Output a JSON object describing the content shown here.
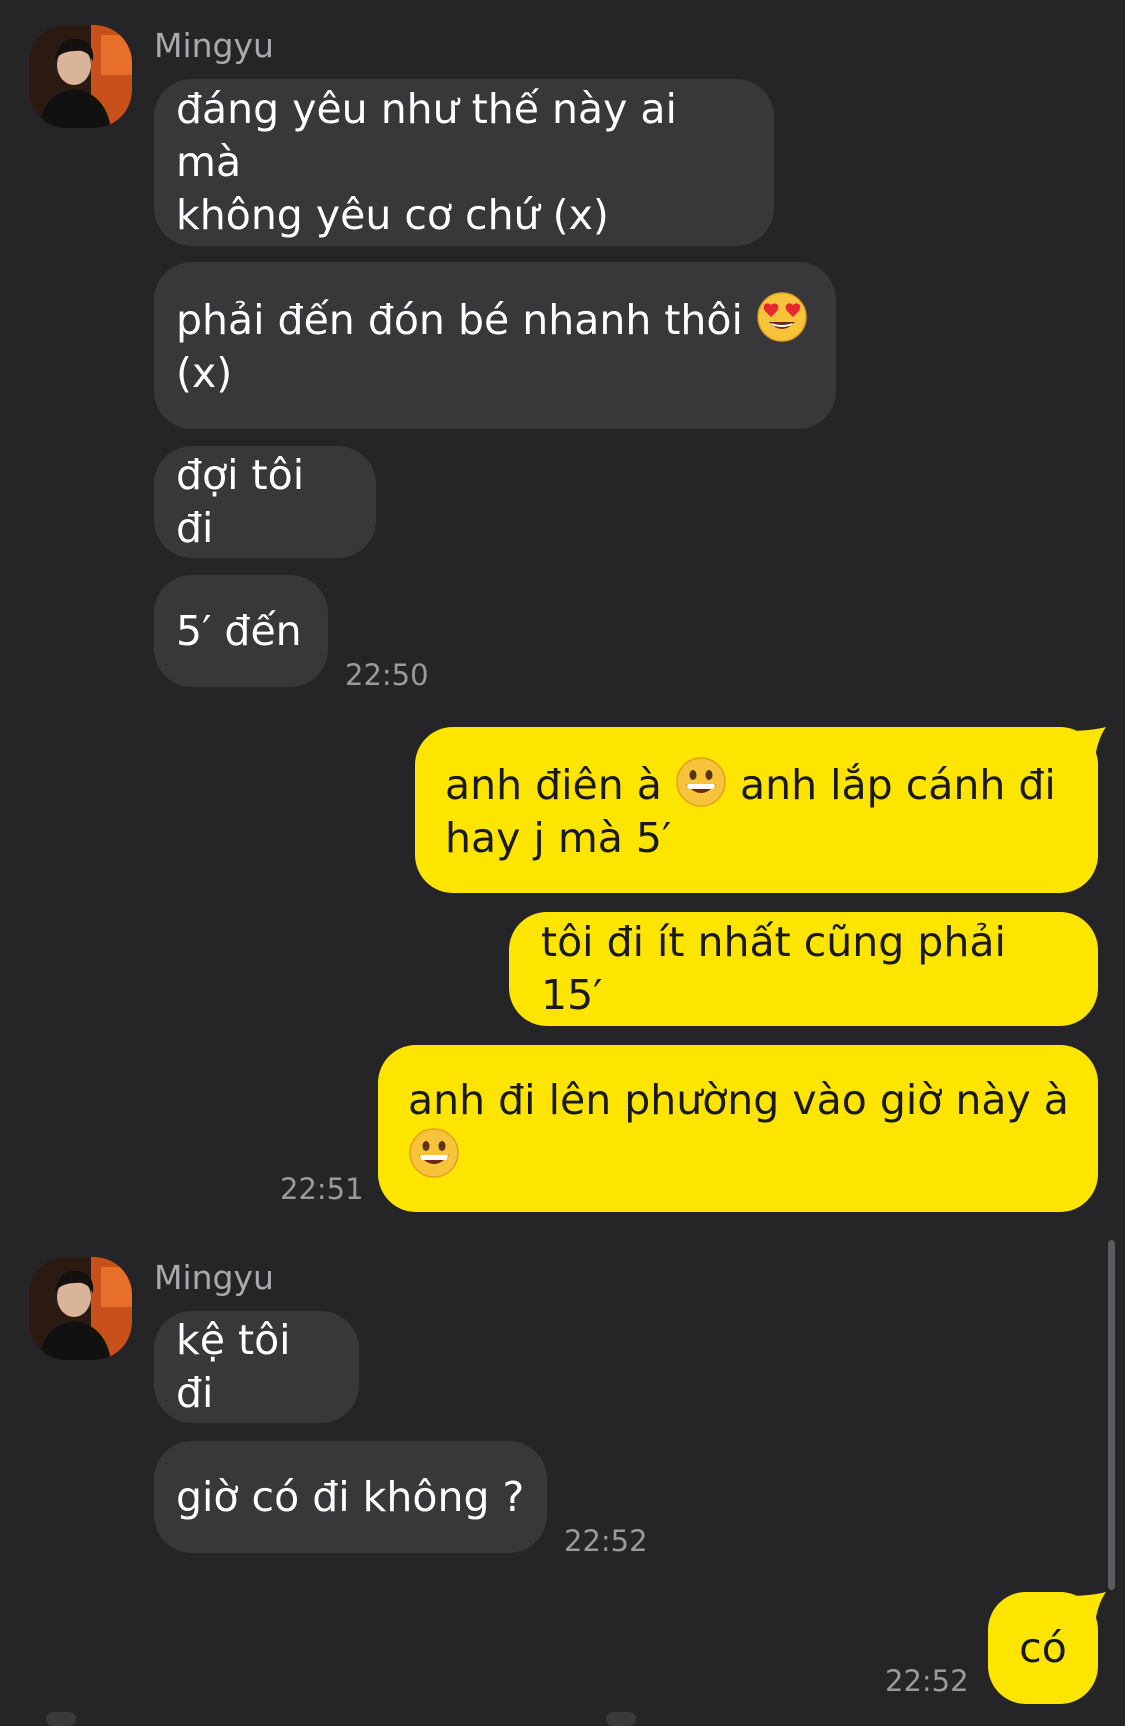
{
  "chat": {
    "group1": {
      "sender": "Mingyu",
      "messages": [
        {
          "before": "đáng yêu như thế này ai mà\nkhông yêu cơ chứ (x)"
        },
        {
          "before": "phải đến đón bé nhanh thôi ",
          "emoji": "heart-eyes",
          "after": "\n(x)"
        },
        {
          "before": "đợi tôi đi"
        },
        {
          "before": "5′ đến"
        }
      ],
      "time": "22:50"
    },
    "group2": {
      "messages": [
        {
          "before": "anh điên à ",
          "emoji": "grin",
          "after": " anh lắp cánh đi\nhay j mà 5′"
        },
        {
          "before": "tôi đi ít nhất cũng phải 15′"
        },
        {
          "before": "anh đi lên phường vào giờ này à\n",
          "emoji": "grin"
        }
      ],
      "time": "22:51"
    },
    "group3": {
      "sender": "Mingyu",
      "messages": [
        {
          "before": "kệ tôi đi"
        },
        {
          "before": "giờ có đi không ?"
        }
      ],
      "time": "22:52"
    },
    "group4": {
      "messages": [
        {
          "before": "có"
        }
      ],
      "time": "22:52"
    }
  },
  "colors": {
    "background": "#252527",
    "incoming_bubble": "#38383b",
    "outgoing_bubble": "#fee500"
  }
}
